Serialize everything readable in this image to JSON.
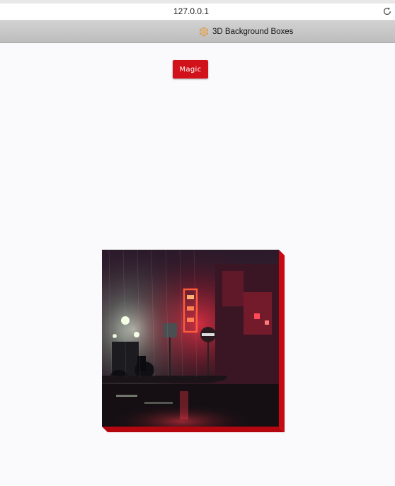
{
  "browser": {
    "url": "127.0.0.1",
    "reload_icon": "reload-icon",
    "tab_title": "3D Background Boxes",
    "favicon": "cube-favicon-icon"
  },
  "page": {
    "magic_button_label": "Magic",
    "accent_color": "#d2121a",
    "background_color": "#fafafc"
  },
  "boxes_image": {
    "description_icon": "night-street-photo",
    "side_color": "#c80813"
  }
}
